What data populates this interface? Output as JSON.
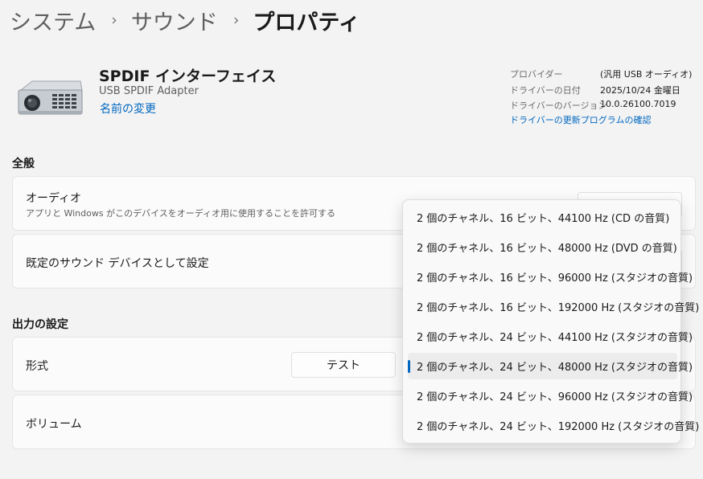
{
  "breadcrumb": {
    "items": [
      "システム",
      "サウンド",
      "プロパティ"
    ],
    "separator": "›"
  },
  "device": {
    "name": "SPDIF インターフェイス",
    "subtitle": "USB SPDIF Adapter",
    "rename_link": "名前の変更",
    "icon": "speaker-device-icon"
  },
  "driver_info": {
    "provider_label": "プロバイダー",
    "provider_value": "(汎用 USB オーディオ)",
    "date_label": "ドライバーの日付",
    "date_value": "2025/10/24 金曜日",
    "version_label": "ドライバーのバージョン",
    "version_value": "10.0.26100.7019",
    "update_link": "ドライバーの更新プログラムの確認"
  },
  "general": {
    "section_title": "全般",
    "audio": {
      "title": "オーディオ",
      "description": "アプリと Windows がこのデバイスをオーディオ用に使用することを許可する"
    },
    "default_device": {
      "title": "既定のサウンド デバイスとして設定"
    }
  },
  "output": {
    "section_title": "出力の設定",
    "format": {
      "title": "形式",
      "test_button": "テスト"
    },
    "volume": {
      "title": "ボリューム"
    }
  },
  "format_dropdown": {
    "options": [
      "2 個のチャネル、16 ビット、44100 Hz (CD の音質)",
      "2 個のチャネル、16 ビット、48000 Hz (DVD の音質)",
      "2 個のチャネル、16 ビット、96000 Hz (スタジオの音質)",
      "2 個のチャネル、16 ビット、192000 Hz (スタジオの音質)",
      "2 個のチャネル、24 ビット、44100 Hz (スタジオの音質)",
      "2 個のチャネル、24 ビット、48000 Hz (スタジオの音質)",
      "2 個のチャネル、24 ビット、96000 Hz (スタジオの音質)",
      "2 個のチャネル、24 ビット、192000 Hz (スタジオの音質)"
    ],
    "selected_index": 5
  },
  "colors": {
    "accent": "#0067c0",
    "background": "#f3f3f3",
    "card": "#fbfbfb"
  }
}
